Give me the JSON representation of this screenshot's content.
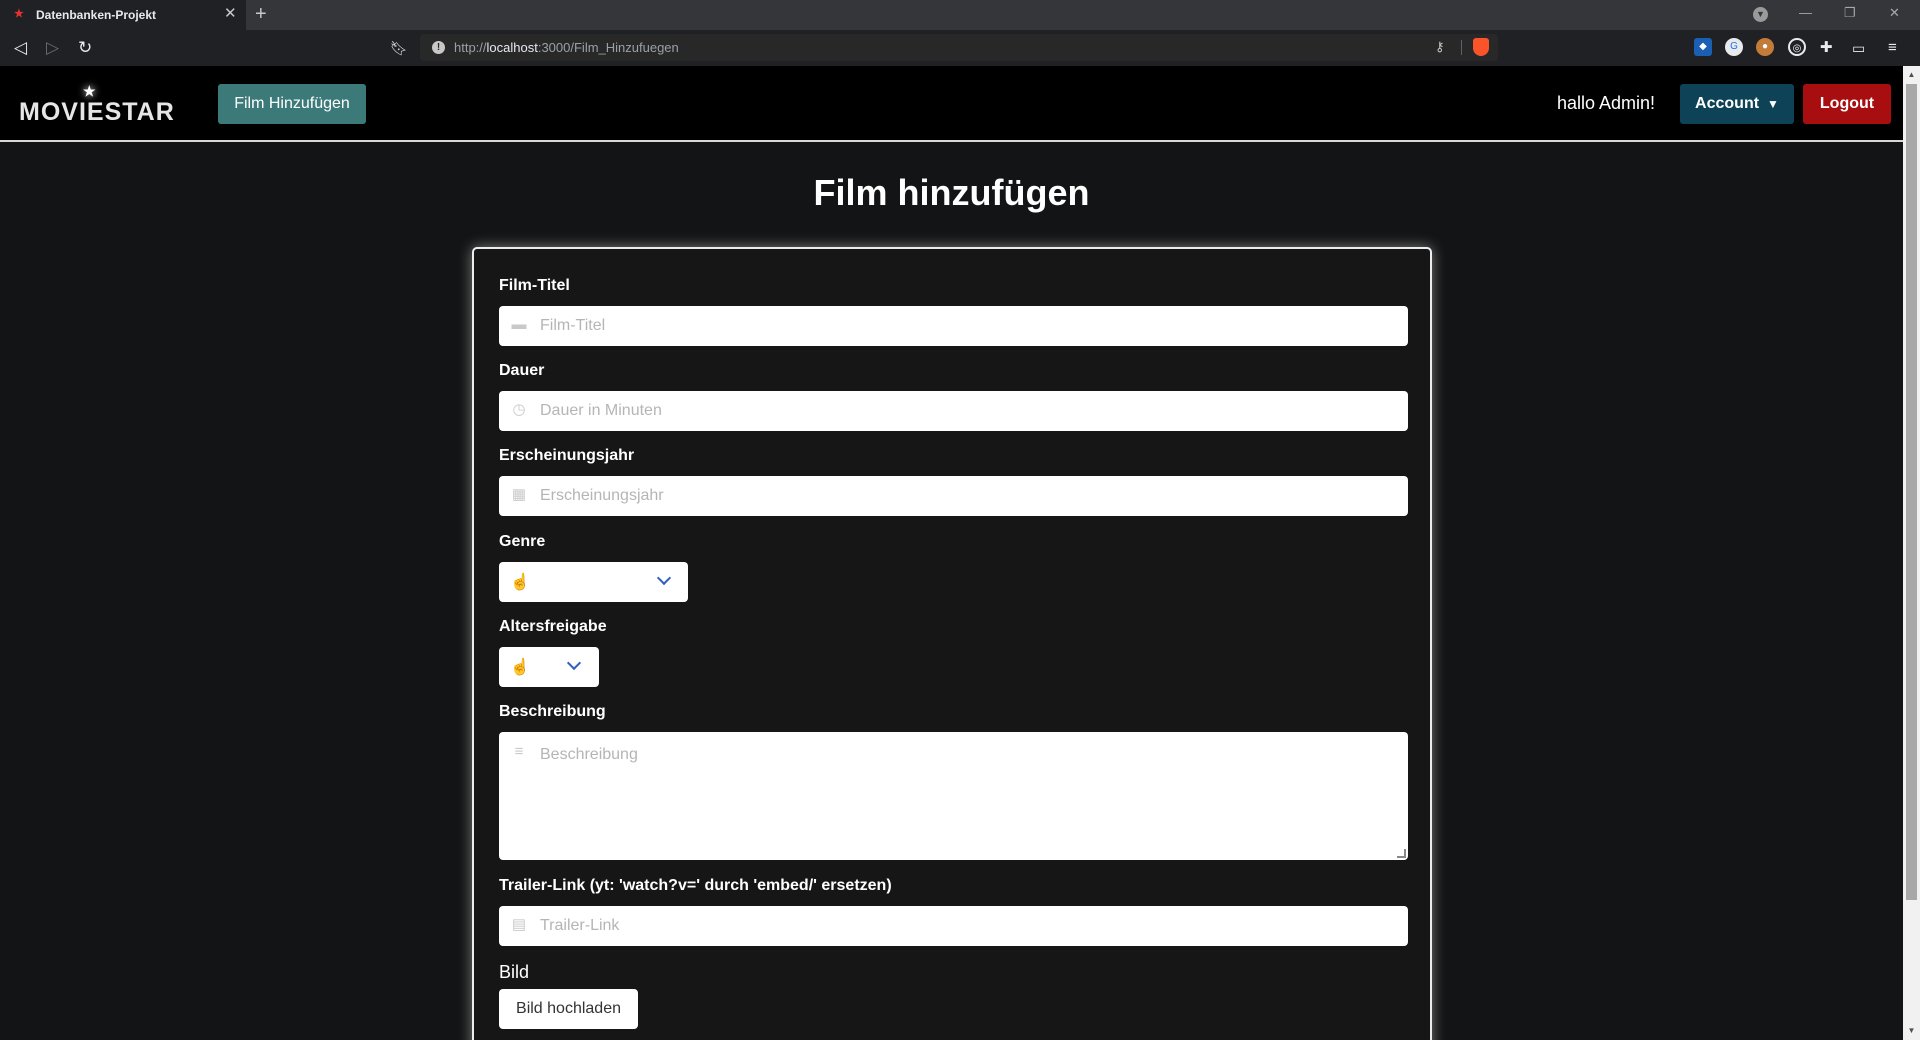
{
  "browser": {
    "tab_title": "Datenbanken-Projekt",
    "url_prefix": "http://",
    "url_host": "localhost",
    "url_path": ":3000/Film_Hinzufuegen"
  },
  "navbar": {
    "logo_text": "MOVIESTAR",
    "add_film_label": "Film Hinzufügen",
    "greeting": "hallo Admin!",
    "account_label": "Account",
    "logout_label": "Logout"
  },
  "page": {
    "title": "Film hinzufügen"
  },
  "form": {
    "title_label": "Film-Titel",
    "title_placeholder": "Film-Titel",
    "duration_label": "Dauer",
    "duration_placeholder": "Dauer in Minuten",
    "year_label": "Erscheinungsjahr",
    "year_placeholder": "Erscheinungsjahr",
    "genre_label": "Genre",
    "age_label": "Altersfreigabe",
    "description_label": "Beschreibung",
    "description_placeholder": "Beschreibung",
    "trailer_label": "Trailer-Link (yt: 'watch?v=' durch 'embed/' ersetzen)",
    "trailer_placeholder": "Trailer-Link",
    "image_label": "Bild",
    "upload_label": "Bild hochladen"
  },
  "colors": {
    "add_film_button": "#3b7a78",
    "account_button": "#0e4256",
    "logout_button": "#a80d10",
    "page_background": "#131415"
  }
}
